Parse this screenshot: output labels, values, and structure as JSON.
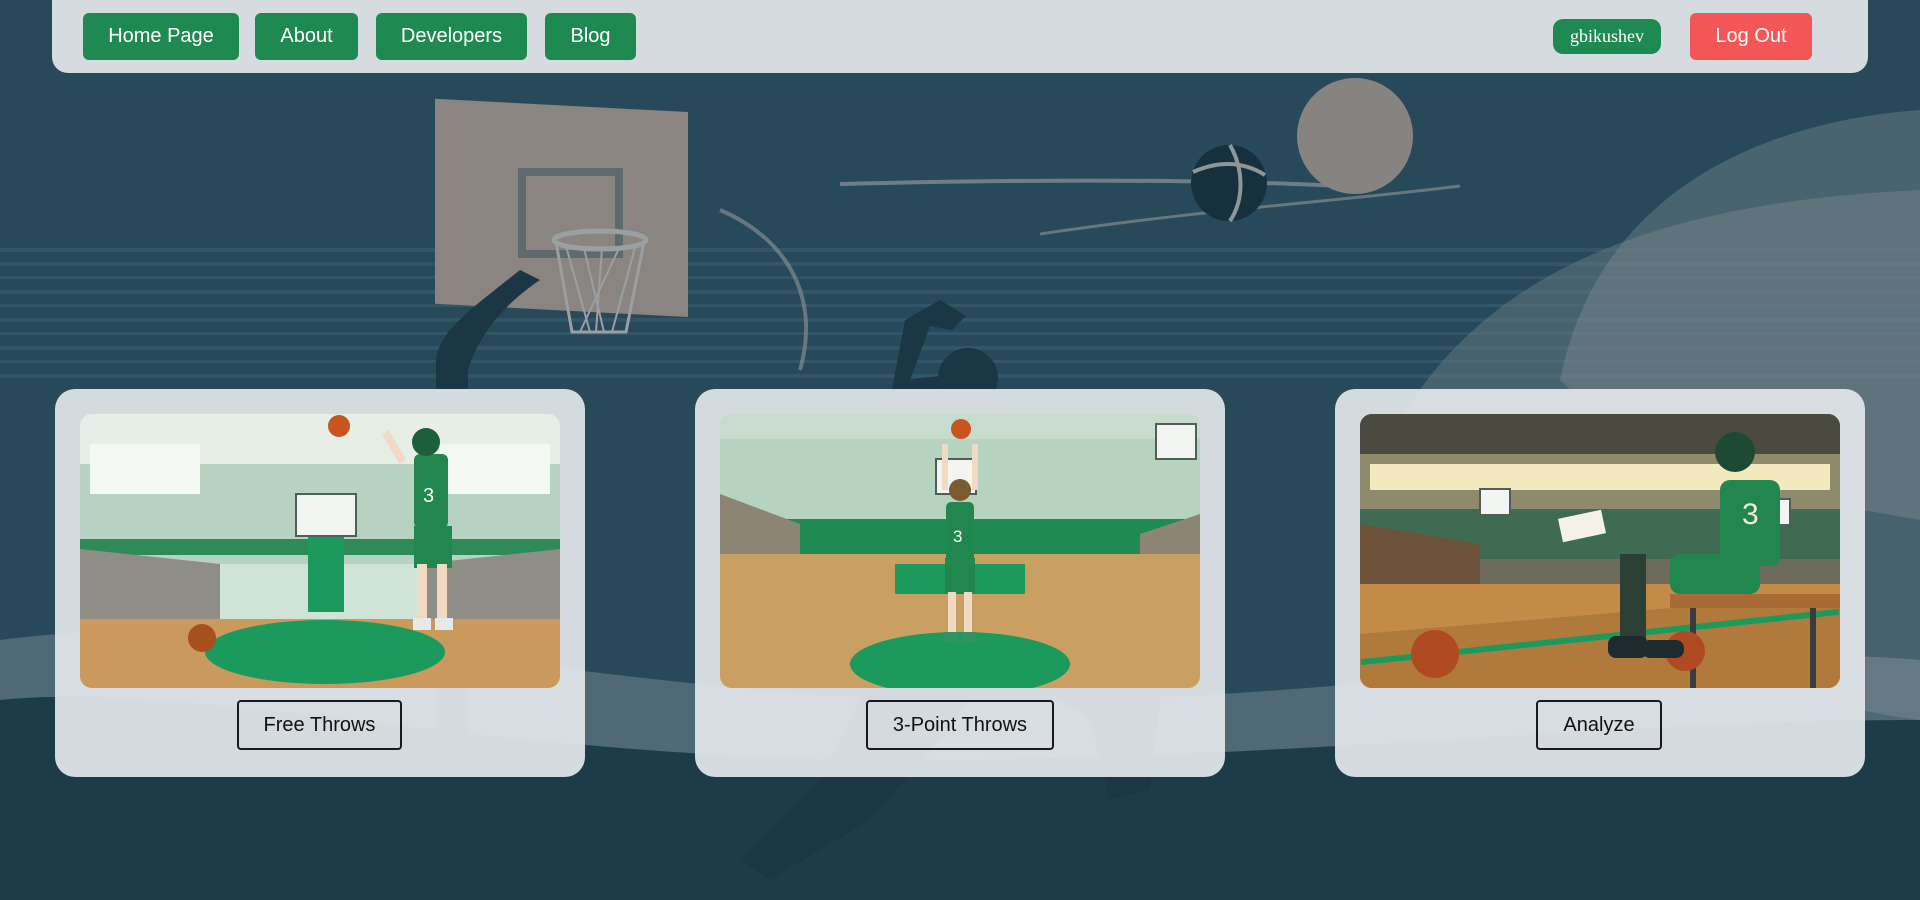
{
  "nav": {
    "items": [
      {
        "label": "Home Page"
      },
      {
        "label": "About"
      },
      {
        "label": "Developers"
      },
      {
        "label": "Blog"
      }
    ],
    "username": "gbikushev",
    "logout_label": "Log Out"
  },
  "cards": [
    {
      "button_label": "Free Throws"
    },
    {
      "button_label": "3-Point Throws"
    },
    {
      "button_label": "Analyze"
    }
  ],
  "colors": {
    "page_background": "#27495a",
    "nav_button": "#1e8a52",
    "logout_button": "#f35657",
    "navbar_background": "#d6dbdf",
    "card_background": "#e2e6e9",
    "court_green": "#1c9a5e",
    "court_wood": "#c99a5c"
  }
}
